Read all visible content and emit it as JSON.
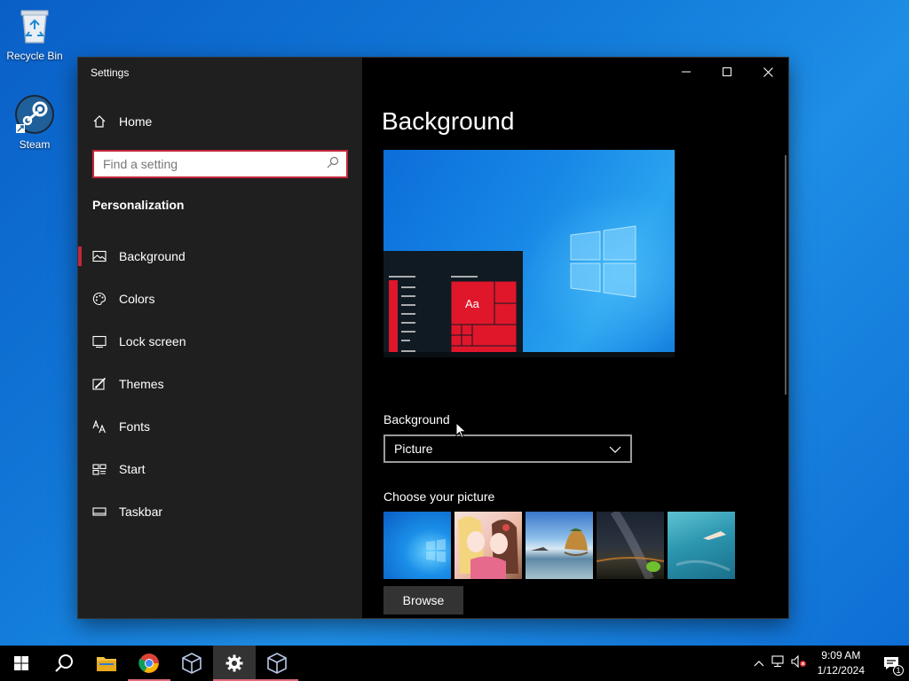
{
  "desktop": {
    "icons": [
      {
        "label": "Recycle Bin",
        "icon": "recycle-bin-icon"
      },
      {
        "label": "Steam",
        "icon": "steam-icon"
      }
    ]
  },
  "window": {
    "title": "Settings",
    "controls": [
      "minimize",
      "maximize",
      "close"
    ]
  },
  "sidebar": {
    "home_label": "Home",
    "search_placeholder": "Find a setting",
    "section_title": "Personalization",
    "items": [
      {
        "label": "Background",
        "icon": "picture-icon",
        "active": true
      },
      {
        "label": "Colors",
        "icon": "palette-icon",
        "active": false
      },
      {
        "label": "Lock screen",
        "icon": "lock-screen-icon",
        "active": false
      },
      {
        "label": "Themes",
        "icon": "themes-icon",
        "active": false
      },
      {
        "label": "Fonts",
        "icon": "fonts-icon",
        "active": false
      },
      {
        "label": "Start",
        "icon": "start-icon",
        "active": false
      },
      {
        "label": "Taskbar",
        "icon": "taskbar-icon",
        "active": false
      }
    ]
  },
  "main": {
    "page_title": "Background",
    "preview_tile_text": "Aa",
    "background_label": "Background",
    "background_value": "Picture",
    "choose_label": "Choose your picture",
    "browse_label": "Browse",
    "thumbnails": [
      "windows-blue",
      "anime-girls",
      "beach-rock",
      "night-sky",
      "underwater-swimmer"
    ]
  },
  "taskbar": {
    "apps": [
      "start",
      "search",
      "file-explorer",
      "chrome",
      "virtualbox",
      "settings",
      "virtualbox"
    ],
    "time": "9:09 AM",
    "date": "1/12/2024",
    "notification_count": "1"
  },
  "colors": {
    "accent": "#c4263a",
    "desktop_blue": "#1178d8",
    "sidebar_bg": "#1f1f1f",
    "main_bg": "#000000"
  }
}
